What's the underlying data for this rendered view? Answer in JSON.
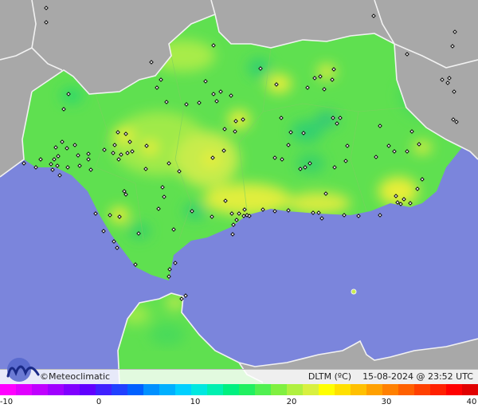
{
  "footer": {
    "brand": "©Meteoclimatic",
    "caption_var": "DLTM (ºC)",
    "caption_date": "15-08-2024 @ 23:52 UTC"
  },
  "colors": {
    "sea": "#7b85dc",
    "land_outside": "#a8a8a8",
    "borders": "#f2f2f2",
    "region_main": "#5fe050",
    "region_warm": "#c8ec4c",
    "station_marker": "#111111"
  },
  "scale": {
    "ticks": [
      "-10",
      "0",
      "10",
      "20",
      "30",
      "40"
    ],
    "colors": [
      "#ff00ff",
      "#e000ff",
      "#c000ff",
      "#a000ff",
      "#8000ff",
      "#6000ff",
      "#4020ff",
      "#2040ff",
      "#0060ff",
      "#0090ff",
      "#00b0ff",
      "#00d0ff",
      "#00e8e0",
      "#00f0b0",
      "#00f080",
      "#20f060",
      "#50f050",
      "#80f040",
      "#b0f040",
      "#d8f040",
      "#ffff00",
      "#ffe000",
      "#ffc000",
      "#ffa000",
      "#ff8000",
      "#ff6000",
      "#ff4000",
      "#ff2000",
      "#ff0000",
      "#e00000"
    ]
  }
}
